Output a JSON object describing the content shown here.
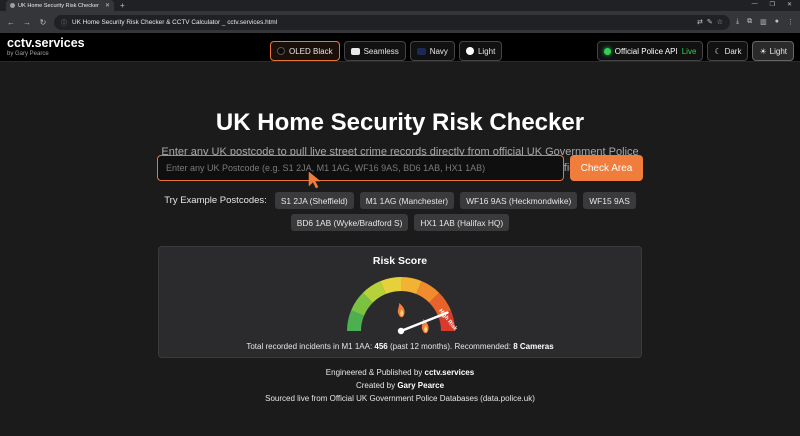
{
  "browser": {
    "tab_title": "UK Home Security Risk Checker",
    "url": "UK Home Security Risk Checker & CCTV Calculator _ cctv.services.html"
  },
  "header": {
    "brand_name": "cctv.services",
    "brand_by": "by Gary Pearce",
    "themes": [
      {
        "label": "OLED Black",
        "swatch": "#0a0a0a",
        "active": true
      },
      {
        "label": "Seamless",
        "swatch": "#e8e8e8",
        "active": false
      },
      {
        "label": "Navy",
        "swatch": "#1b2a55",
        "active": false
      },
      {
        "label": "Light",
        "swatch": "#ffffff",
        "active": false
      }
    ],
    "api_label": "Official Police API",
    "api_status": "Live",
    "mode_dark": "Dark",
    "mode_light": "Light"
  },
  "hero": {
    "title": "UK Home Security Risk Checker",
    "subtitle": "Enter any UK postcode to pull live street crime records directly from official UK Government Police servers (data.police.uk ≤ 1.0 mile) and calculate custom CCTV system specifications."
  },
  "search": {
    "placeholder": "Enter any UK Postcode (e.g. S1 2JA, M1 1AG, WF16 9AS, BD6 1AB, HX1 1AB)",
    "button": "Check Area"
  },
  "examples": {
    "label": "Try Example Postcodes:",
    "items": [
      "S1 2JA (Sheffield)",
      "M1 1AG (Manchester)",
      "WF16 9AS (Heckmondwike)",
      "WF15 9AS",
      "BD6 1AB (Wyke/Bradford S)",
      "HX1 1AB (Halifax HQ)"
    ]
  },
  "risk": {
    "title": "Risk Score",
    "gauge_label": "High Risk",
    "level": 0.88,
    "summary_prefix": "Total recorded incidents in M1 1AA:",
    "incidents": "456",
    "summary_mid": "(past 12 months). Recommended:",
    "recommended": "8 Cameras"
  },
  "footer": {
    "line1_prefix": "Engineered & Published by",
    "line1_brand": "cctv.services",
    "line2_prefix": "Created by",
    "line2_name": "Gary Pearce",
    "line3": "Sourced live from Official UK Government Police Databases (data.police.uk)"
  },
  "colors": {
    "accent": "#f07d3c",
    "live": "#31d157",
    "background": "#1b1b1c"
  }
}
